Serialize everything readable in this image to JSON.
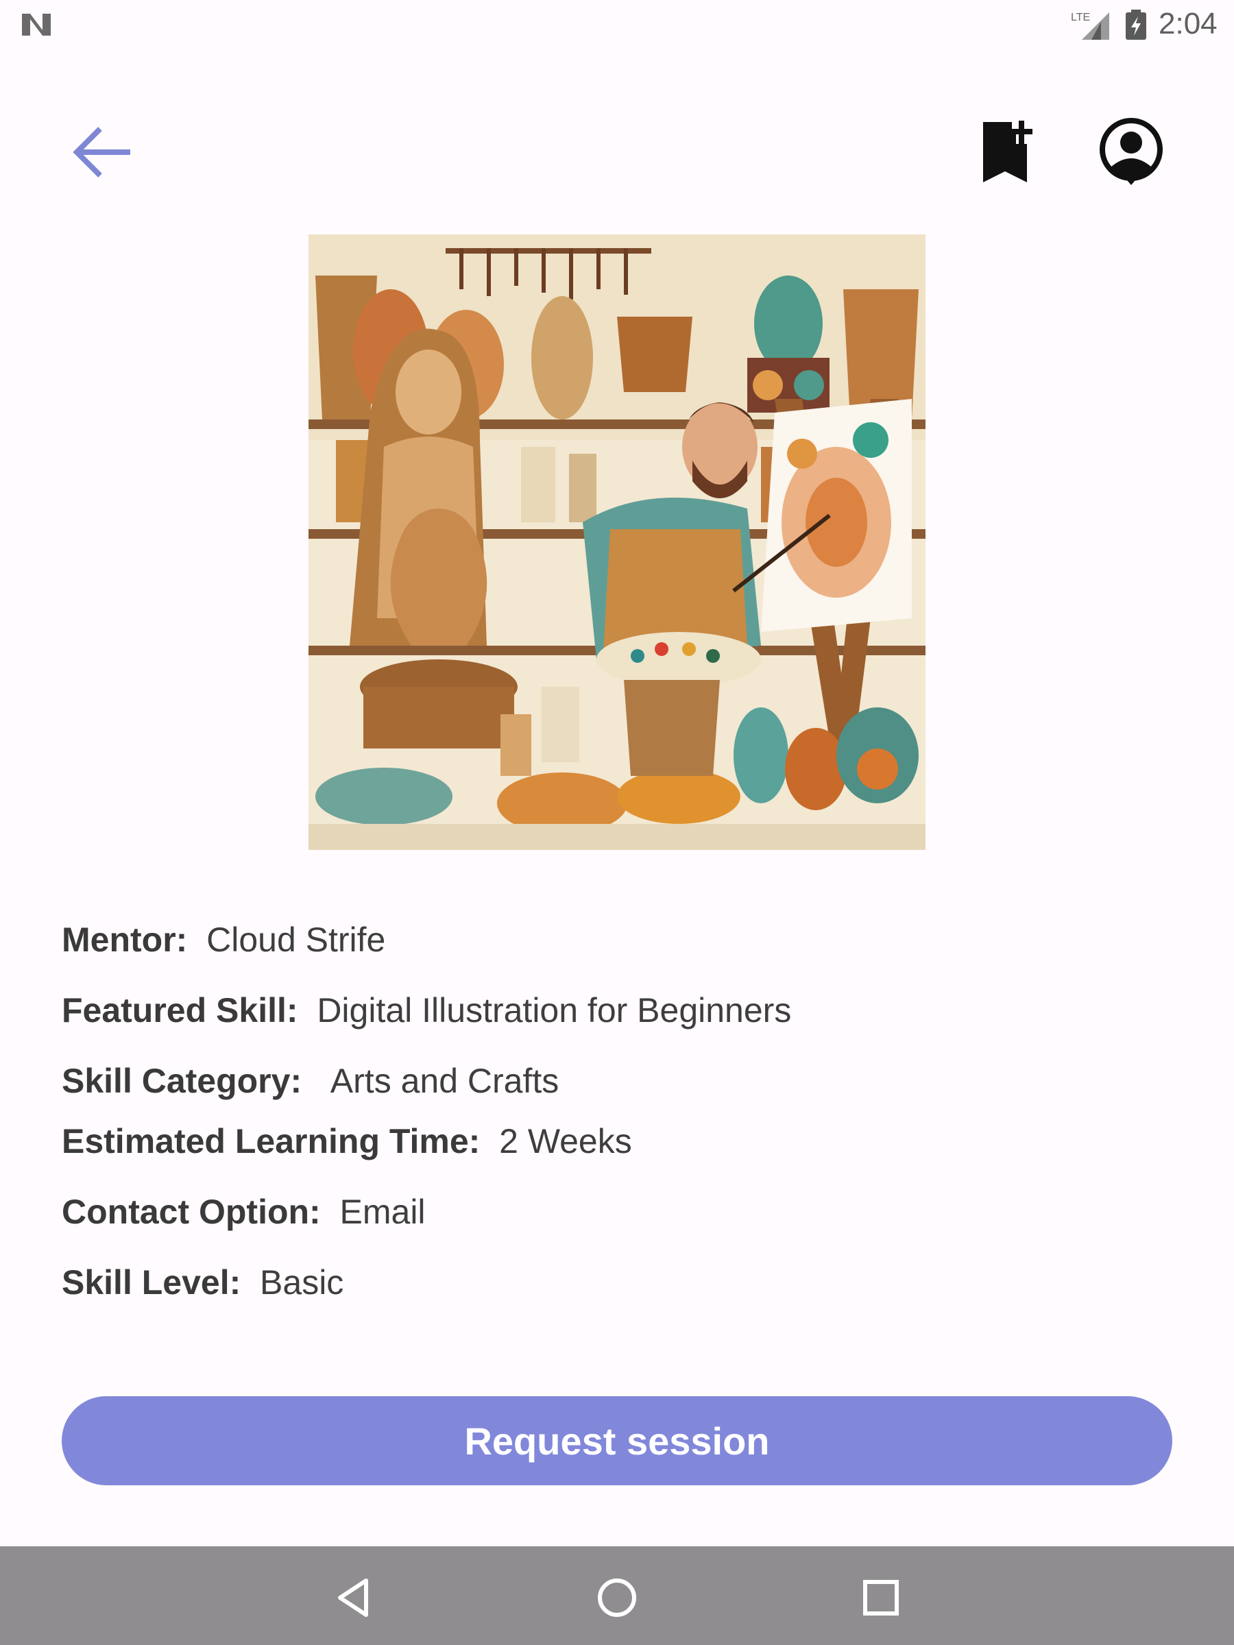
{
  "status_bar": {
    "time": "2:04",
    "network_label": "LTE",
    "notification_icon": "n-notification-icon",
    "signal_icon": "signal-icon",
    "battery_icon": "battery-charging-icon"
  },
  "app_bar": {
    "back_icon": "arrow-back-icon",
    "bookmark_icon": "bookmark-add-icon",
    "profile_icon": "account-circle-icon"
  },
  "hero_image": {
    "icon": "pottery-painting-illustration"
  },
  "details": {
    "mentor": {
      "label": "Mentor:",
      "value": "Cloud Strife"
    },
    "featured_skill": {
      "label": "Featured Skill:",
      "value": "Digital Illustration for Beginners"
    },
    "skill_category": {
      "label": "Skill Category:",
      "value": "Arts and Crafts"
    },
    "learning_time": {
      "label": "Estimated Learning Time:",
      "value": "2 Weeks"
    },
    "contact_option": {
      "label": "Contact Option:",
      "value": "Email"
    },
    "skill_level": {
      "label": "Skill Level:",
      "value": "Basic"
    }
  },
  "actions": {
    "request_label": "Request session"
  },
  "nav_bar": {
    "back_icon": "nav-back-icon",
    "home_icon": "nav-home-icon",
    "recents_icon": "nav-recents-icon"
  },
  "colors": {
    "background": "#fffbfe",
    "accent": "#8188da",
    "back_arrow": "#7e86d6",
    "nav_bar": "#8f8d90"
  }
}
